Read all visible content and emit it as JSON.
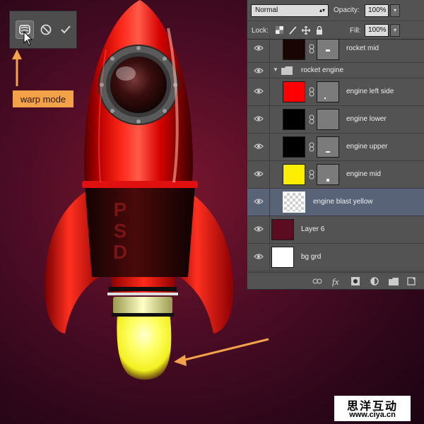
{
  "colors": {
    "accent_orange": "#f4a24a",
    "rocket_red": "#e01010",
    "selected_row": "#586378",
    "panel_bg": "#535353"
  },
  "artwork": {
    "rocket_text": "PSD"
  },
  "warp_toolbar": {
    "buttons": [
      {
        "icon": "warp-icon",
        "active": true
      },
      {
        "icon": "cancel-icon",
        "active": false
      },
      {
        "icon": "commit-check-icon",
        "active": false
      }
    ]
  },
  "callout": {
    "label": "warp mode"
  },
  "layers_panel": {
    "blend_mode": "Normal",
    "opacity_label": "Opacity:",
    "opacity_value": "100%",
    "lock_label": "Lock:",
    "fill_label": "Fill:",
    "fill_value": "100%",
    "layers": [
      {
        "name": "rocket mid",
        "thumb_color": "#1a0505",
        "has_mask": true
      },
      {
        "name": "rocket engine",
        "type": "group",
        "expanded": true
      },
      {
        "name": "engine left side",
        "thumb_color": "#ff0000",
        "has_mask": true
      },
      {
        "name": "engine lower",
        "thumb_color": "#000000",
        "has_mask": true
      },
      {
        "name": "engine upper",
        "thumb_color": "#000000",
        "has_mask": true
      },
      {
        "name": "engine mid",
        "thumb_color": "#ffee00",
        "has_mask": true
      },
      {
        "name": "engine blast yellow",
        "thumb": "transparent",
        "selected": true
      },
      {
        "name": "Layer 6",
        "thumb_color": "#5a0c20"
      },
      {
        "name": "bg grd",
        "thumb_color": "#ffffff"
      }
    ],
    "footer_icons": [
      "link-layers-icon",
      "fx-icon",
      "add-mask-icon",
      "adjustment-layer-icon",
      "new-group-icon",
      "new-layer-icon"
    ],
    "fx_text": "fx"
  },
  "watermark": {
    "chinese": "思洋互动",
    "url": "www.ciya.cn"
  }
}
